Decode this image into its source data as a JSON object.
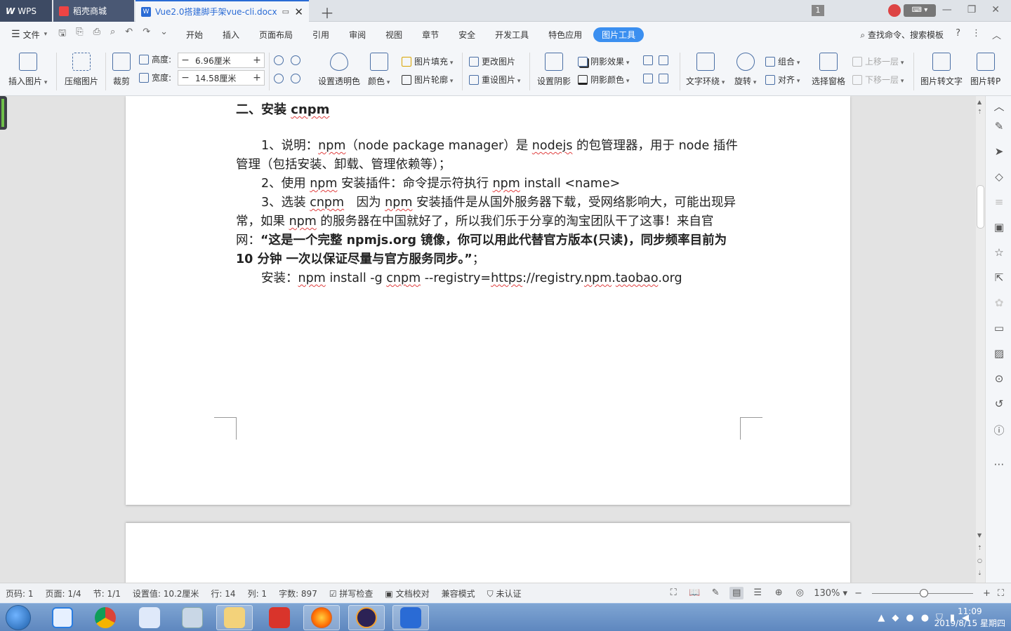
{
  "tabs": {
    "wps": "WPS",
    "store": "稻壳商城",
    "doc": "Vue2.0搭建脚手架vue-cli.docx"
  },
  "window": {
    "badge": "1"
  },
  "menu": {
    "file": "文件",
    "items": [
      "开始",
      "插入",
      "页面布局",
      "引用",
      "审阅",
      "视图",
      "章节",
      "安全",
      "开发工具",
      "特色应用"
    ],
    "active": "图片工具",
    "search": "查找命令、搜索模板",
    "help": "?"
  },
  "ribbon": {
    "insert_picture": "插入图片",
    "compress": "压缩图片",
    "crop": "裁剪",
    "height_label": "高度:",
    "height_value": "6.96厘米",
    "width_label": "宽度:",
    "width_value": "14.58厘米",
    "transparent": "设置透明色",
    "color": "颜色",
    "fill": "图片填充",
    "outline": "图片轮廓",
    "change_pic": "更改图片",
    "reset_pic": "重设图片",
    "set_shadow": "设置阴影",
    "shadow_effect": "阴影效果",
    "shadow_color": "阴影颜色",
    "wrap": "文字环绕",
    "rotate": "旋转",
    "group": "组合",
    "align": "对齐",
    "select_pane": "选择窗格",
    "bring_forward": "上移一层",
    "send_backward": "下移一层",
    "pic_to_text": "图片转文字",
    "pic_to_pdf": "图片转P"
  },
  "document": {
    "heading_prefix": "二、安装 ",
    "heading_word": "cnpm",
    "p1": {
      "a": "1、说明：",
      "b": "npm",
      "c": "（node package manager）是 ",
      "d": "nodejs",
      "e": " 的包管理器，用于 node 插件管理（包括安装、卸载、管理依赖等）；"
    },
    "p2": {
      "a": "2、使用 ",
      "b": "npm",
      "c": " 安装插件：命令提示符执行 ",
      "d": "npm",
      "e": " install <name>"
    },
    "p3": {
      "a": "3、选装 ",
      "b": "cnpm",
      "c": "　因为 ",
      "d": "npm",
      "e": " 安装插件是从国外服务器下载，受网络影响大，可能出现异常，如果 ",
      "f": "npm",
      "g": " 的服务器在中国就好了，所以我们乐于分享的淘宝团队干了这事！来自官网：",
      "h": "“这是一个完整 npmjs.org 镜像，你可以用此代替官方版本(只读)，同步频率目前为 10 分钟 一次以保证尽量与官方服务同步。”",
      "i": "；"
    },
    "p4": {
      "a": "安装：",
      "b": "npm",
      "c": " install -g ",
      "d": "cnpm",
      "e": " --registry=",
      "f": "https",
      "g": "://registry.",
      "h": "npm",
      "i": ".",
      "j": "taobao",
      "k": ".org"
    }
  },
  "status": {
    "page_code": "页码: 1",
    "page": "页面: 1/4",
    "section": "节: 1/1",
    "setting": "设置值: 10.2厘米",
    "row": "行: 14",
    "col": "列: 1",
    "words": "字数: 897",
    "spell": "拼写检查",
    "proof": "文档校对",
    "compat": "兼容模式",
    "cert": "未认证",
    "zoom": "130%"
  },
  "clock": {
    "time": "11:09",
    "date": "2019/8/15 星期四"
  },
  "colors": {
    "accent": "#3b8ff0",
    "tab_dark": "#3d4a63",
    "taskbar": "#5e87bf"
  }
}
